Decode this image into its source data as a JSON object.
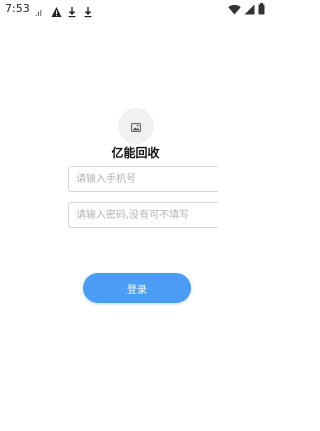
{
  "status_bar": {
    "time": "7:53",
    "left_icons": [
      "sim-icon",
      "warning-icon",
      "download-icon",
      "download-icon"
    ],
    "right_icons": [
      "wifi-icon",
      "signal-icon",
      "battery-icon"
    ]
  },
  "app": {
    "logo_icon": "image-placeholder-icon",
    "name": "亿能回收"
  },
  "form": {
    "phone_placeholder": "请输入手机号",
    "phone_value": "",
    "password_placeholder": "请输入密码,没有可不填写",
    "password_value": "",
    "login_label": "登录",
    "accent_color": "#4a9cf5"
  }
}
